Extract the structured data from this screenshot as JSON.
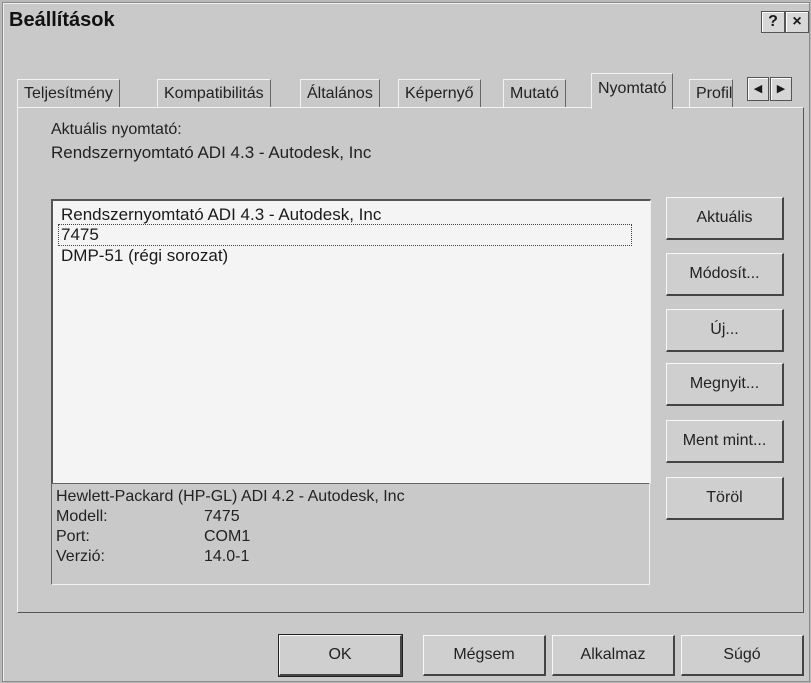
{
  "window": {
    "title": "Beállítások",
    "help_label": "?",
    "close_label": "×"
  },
  "tabs": [
    {
      "label": "Teljesítmény"
    },
    {
      "label": "Kompatibilitás"
    },
    {
      "label": "Általános"
    },
    {
      "label": "Képernyő"
    },
    {
      "label": "Mutató"
    },
    {
      "label": "Nyomtató",
      "active": true
    },
    {
      "label": "Profil"
    }
  ],
  "tab_scroll": {
    "left": "◀",
    "right": "▶"
  },
  "current_printer": {
    "label": "Aktuális nyomtató:",
    "value": "Rendszernyomtató ADI 4.3 - Autodesk, Inc"
  },
  "printer_list": [
    "Rendszernyomtató ADI 4.3 - Autodesk, Inc",
    "7475",
    "DMP-51 (régi sorozat)"
  ],
  "info": {
    "driver": "Hewlett-Packard (HP-GL) ADI 4.2 - Autodesk, Inc",
    "model_label": "Modell:",
    "model_value": "7475",
    "port_label": "Port:",
    "port_value": "COM1",
    "version_label": "Verzió:",
    "version_value": "14.0-1"
  },
  "side_buttons": {
    "aktualis": "Aktuális",
    "modosit": "Módosít...",
    "uj": "Új...",
    "megnyit": "Megnyit...",
    "ment_mint": "Ment mint...",
    "torol": "Töröl"
  },
  "bottom_buttons": {
    "ok": "OK",
    "megsem": "Mégsem",
    "alkalmaz": "Alkalmaz",
    "sugo": "Súgó"
  }
}
